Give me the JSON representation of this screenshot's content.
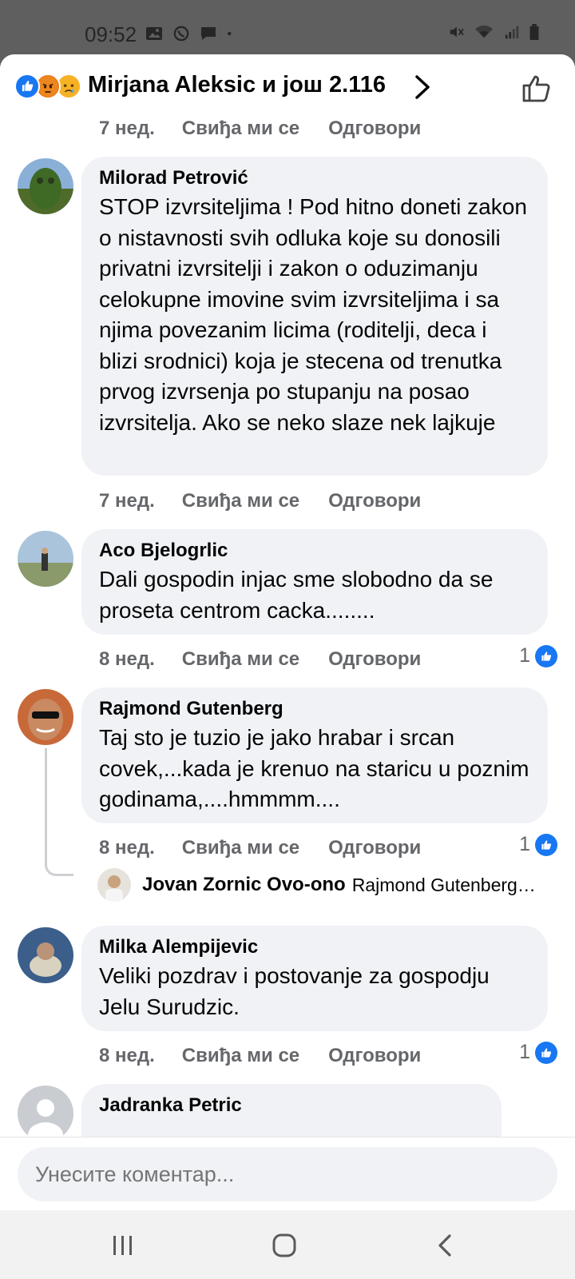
{
  "status_bar": {
    "time": "09:52"
  },
  "header": {
    "title": "Mirjana Aleksic и још 2.116",
    "reactions": [
      "like-icon",
      "angry-icon",
      "sad-icon"
    ],
    "accent": "#1877f2"
  },
  "labels": {
    "like": "Свиђа ми се",
    "reply": "Одговори"
  },
  "top_meta": {
    "time": "7 нед."
  },
  "comments": [
    {
      "author": "Milorad Petrović",
      "text": "STOP izvrsiteljima ! Pod hitno doneti zakon o nistavnosti svih odluka koje su donosili privatni izvrsitelji i zakon o oduzimanju celokupne imovine svim izvrsiteljima i sa njima povezanim licima (roditelji, deca i blizi srodnici) koja je stecena od trenutka prvog izvrsenja po stupanju na posao izvrsitelja. Ako se neko slaze nek lajkuje",
      "time": "7 нед."
    },
    {
      "author": "Aco Bjelogrlic",
      "text": "Dali gospodin injac sme slobodno da se proseta centrom cacka........",
      "time": "8 нед.",
      "likes": "1"
    },
    {
      "author": "Rajmond Gutenberg",
      "text": "Taj sto je tuzio je jako hrabar i srcan covek,...kada je krenuo na staricu u poznim godinama,....hmmmm....",
      "time": "8 нед.",
      "likes": "1",
      "reply": {
        "author": "Jovan Zornic Ovo-ono",
        "snippet": "Rajmond Gutenberg…"
      }
    },
    {
      "author": "Milka Alempijevic",
      "text": "Veliki pozdrav  i postovanje za gospodju Jelu Surudzic.",
      "time": "8 нед.",
      "likes": "1"
    },
    {
      "author": "Jadranka Petric"
    }
  ],
  "composer": {
    "placeholder": "Унесите коментар..."
  }
}
